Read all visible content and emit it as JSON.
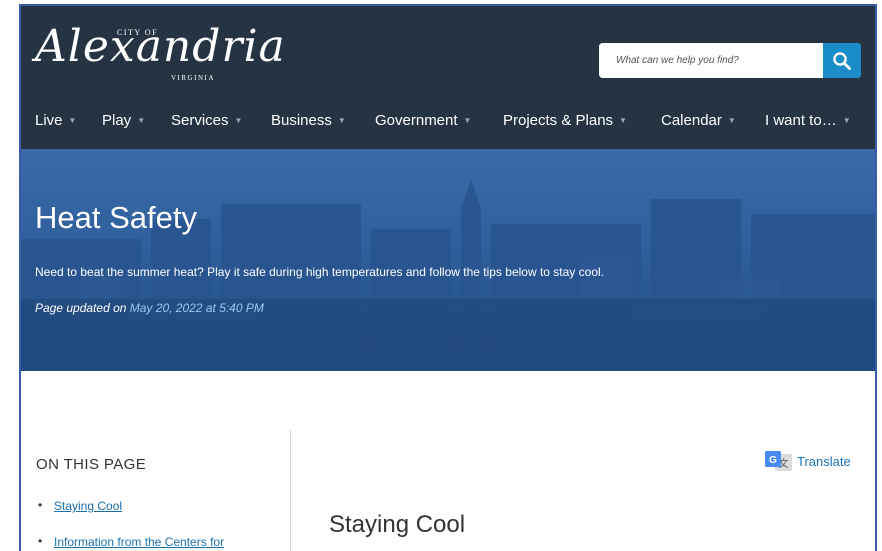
{
  "header": {
    "logo": {
      "city_of": "CITY OF",
      "name": "Alexandria",
      "state": "VIRGINIA"
    },
    "search": {
      "placeholder": "What can we help you find?",
      "value": ""
    },
    "nav": [
      {
        "label": "Live"
      },
      {
        "label": "Play"
      },
      {
        "label": "Services"
      },
      {
        "label": "Business"
      },
      {
        "label": "Government"
      },
      {
        "label": "Projects & Plans"
      },
      {
        "label": "Calendar"
      },
      {
        "label": "I want to…"
      }
    ]
  },
  "hero": {
    "title": "Heat Safety",
    "description": "Need to beat the summer heat? Play it safe during high temperatures and follow the tips below to stay cool.",
    "updated_prefix": "Page updated on",
    "updated_date": "May 20, 2022 at 5:40 PM"
  },
  "sidebar": {
    "title": "ON THIS PAGE",
    "links": [
      {
        "label": "Staying Cool"
      },
      {
        "label": "Information from the Centers for"
      }
    ]
  },
  "main": {
    "translate_label": "Translate",
    "section_title": "Staying Cool"
  },
  "colors": {
    "header_bg": "#253342",
    "hero_bg": "#2a5792",
    "link": "#1a6fae",
    "search_button": "#1a8cc7"
  },
  "icons": [
    "search-icon",
    "nav-caret-icon",
    "google-translate-icon"
  ]
}
